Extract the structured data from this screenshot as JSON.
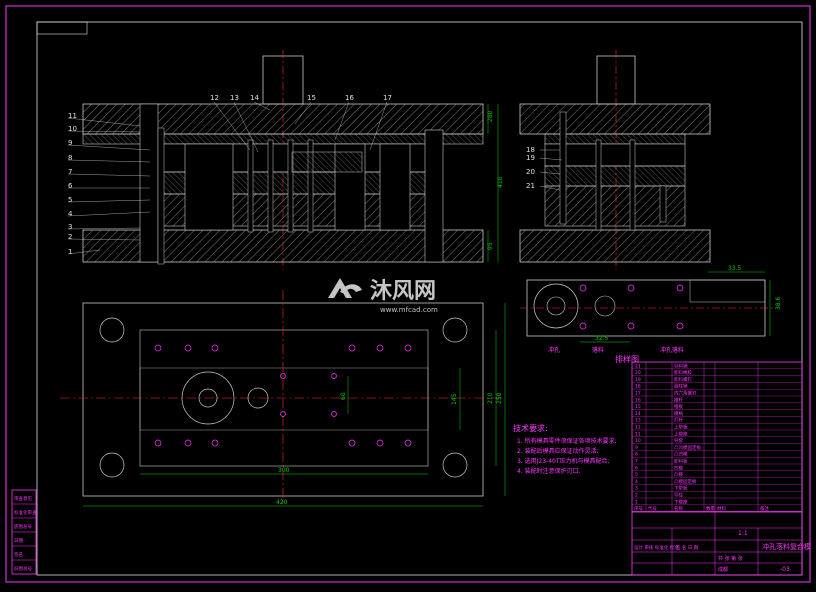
{
  "title_block": {
    "drawing_name": "冲孔落料复合模",
    "scale": "1:1",
    "sheet_note": "共 张  第 张",
    "material": "",
    "company": "成都",
    "designer_row": "设计 审核 标准化 批准",
    "date_row": "签 名 日 期",
    "right_code": "-03"
  },
  "bom": {
    "headers": [
      "序号",
      "代号",
      "名称",
      "数量",
      "材料",
      "备注"
    ],
    "rows": [
      {
        "no": "21",
        "name": "导料销"
      },
      {
        "no": "20",
        "name": "卸料橡胶"
      },
      {
        "no": "19",
        "name": "卸料螺钉"
      },
      {
        "no": "18",
        "name": "圆柱销"
      },
      {
        "no": "17",
        "name": "内六角螺钉"
      },
      {
        "no": "16",
        "name": "推杆"
      },
      {
        "no": "15",
        "name": "推板"
      },
      {
        "no": "14",
        "name": "模柄"
      },
      {
        "no": "13",
        "name": "打杆"
      },
      {
        "no": "12",
        "name": "上垫板"
      },
      {
        "no": "11",
        "name": "上模座"
      },
      {
        "no": "10",
        "name": "导套"
      },
      {
        "no": "9",
        "name": "凸凹模固定板"
      },
      {
        "no": "8",
        "name": "凸凹模"
      },
      {
        "no": "7",
        "name": "卸料板"
      },
      {
        "no": "6",
        "name": "凹模"
      },
      {
        "no": "5",
        "name": "凸模"
      },
      {
        "no": "4",
        "name": "凸模固定板"
      },
      {
        "no": "3",
        "name": "下垫板"
      },
      {
        "no": "2",
        "name": "导柱"
      },
      {
        "no": "1",
        "name": "下模座"
      }
    ]
  },
  "notes": {
    "title": "技术要求:",
    "items": [
      "1. 所有模具零件须保证各项技术要求;",
      "2. 装配后模具应保证动作灵活;",
      "3. 选用J23-40T压力机与模具配合;",
      "4. 装配时注意保护刃口."
    ]
  },
  "front_view": {
    "part_numbers_left": [
      "11",
      "10",
      "9",
      "8",
      "7",
      "6",
      "5",
      "4",
      "3",
      "2",
      "1"
    ],
    "part_numbers_top": [
      "12",
      "13",
      "14",
      "15",
      "16",
      "17"
    ],
    "dims": {
      "right_top": "280",
      "right_mid": "410",
      "right_bot": "95"
    }
  },
  "side_view": {
    "part_numbers": [
      "18",
      "19",
      "20",
      "21"
    ]
  },
  "strip_layout": {
    "caption": "排样图",
    "sub_labels": [
      "冲孔",
      "落料",
      "冲孔落料"
    ],
    "dims": {
      "pitch": "33.5",
      "width": "38.6",
      "offset": "32.5"
    }
  },
  "plan_view": {
    "dims": {
      "width": "300",
      "total": "420",
      "height_inner": "145",
      "h2": "210",
      "h3": "250",
      "h4": "60"
    }
  },
  "left_strip": [
    "审查意见",
    "标准化审查",
    "底图总号",
    "日期",
    "签名",
    "旧图总号"
  ],
  "watermark": {
    "cn": "沐风网",
    "url": "www.mfcad.com"
  },
  "colors": {
    "frame": "#ff33ff",
    "outline": "#c8c8c8",
    "hatch": "#9a9a9a",
    "center": "#ff2a2a",
    "dim": "#00d000",
    "label": "#d8d8d8"
  }
}
